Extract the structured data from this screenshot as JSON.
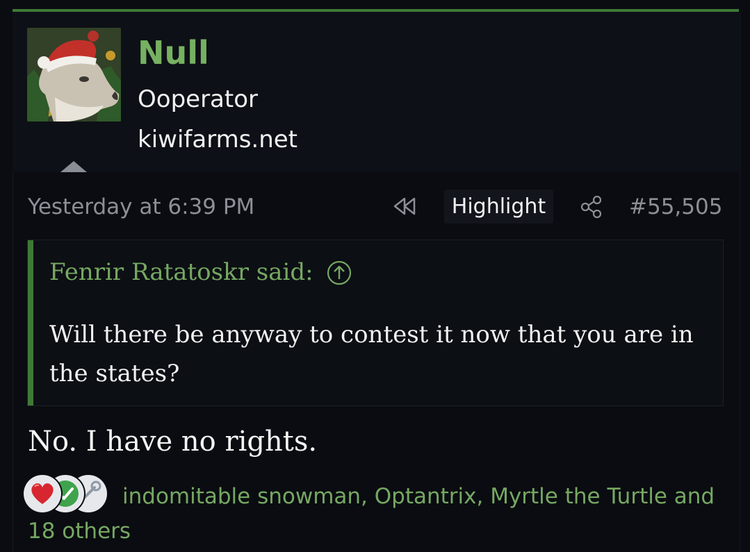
{
  "colors": {
    "accent_green": "#3e7a36",
    "username_green": "#76b161",
    "link_green": "#76a862",
    "background": "#0a0c11",
    "muted_text": "#8c8f96"
  },
  "user": {
    "name": "Null",
    "title": "Ooperator",
    "site": "kiwifarms.net",
    "avatar_icon": "dog-santa-hat-avatar"
  },
  "post_meta": {
    "date": "Yesterday at 6:39 PM",
    "rewind_icon": "rewind-icon",
    "highlight_label": "Highlight",
    "share_icon": "share-icon",
    "post_number": "#55,505"
  },
  "quote": {
    "author": "Fenrir Ratatoskr said:",
    "expand_icon": "arrow-up-circle-icon",
    "text": "Will there be anyway to contest it now that you are in the states?"
  },
  "post": {
    "body": "No. I have no rights."
  },
  "reactions": {
    "icons": [
      "heart-icon",
      "checkmark-icon",
      "wrench-icon"
    ],
    "users_text": "indomitable snowman, Optantrix, Myrtle the Turtle and 18 others"
  }
}
